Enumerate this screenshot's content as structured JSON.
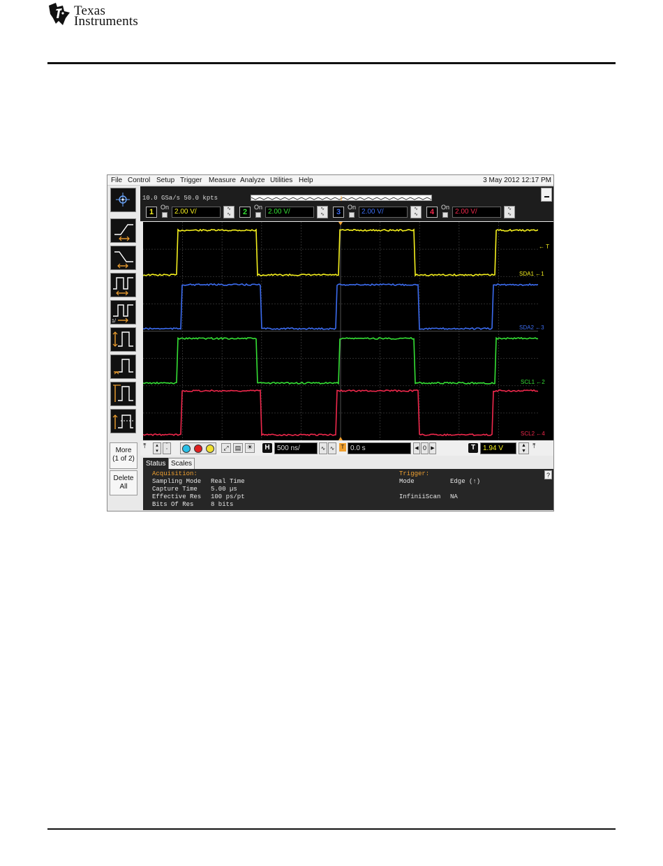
{
  "header": {
    "logo_line1": "Texas",
    "logo_line2": "Instruments"
  },
  "scope": {
    "menu": [
      "File",
      "Control",
      "Setup",
      "Trigger",
      "Measure",
      "Analyze",
      "Utilities",
      "Help"
    ],
    "datetime": "3 May 2012 12:17 PM",
    "sample_rate": "10.0 GSa/s",
    "memory_depth": "50.0 kpts",
    "channels": [
      {
        "number": "1",
        "state": "On",
        "scale": "2.00 V/",
        "color": "#f5f01e"
      },
      {
        "number": "2",
        "state": "On",
        "scale": "2.00 V/",
        "color": "#35e035"
      },
      {
        "number": "3",
        "state": "On",
        "scale": "2.00 V/",
        "color": "#3c6cf0"
      },
      {
        "number": "4",
        "state": "On",
        "scale": "2.00 V/",
        "color": "#f0284c"
      }
    ],
    "left_buttons": {
      "more_label": "More",
      "more_page": "(1 of 2)",
      "delete_line1": "Delete",
      "delete_line2": "All"
    },
    "waveform_labels": {
      "sda1": "SDA1",
      "sda2": "SDA2",
      "scl1": "SCL1",
      "scl2": "SCL2",
      "trigger_marker": "T",
      "ch1_marker": "1",
      "ch2_marker": "2",
      "ch3_marker": "3",
      "ch4_marker": "4"
    },
    "horizontal": {
      "label": "H",
      "timebase": "500 ns/",
      "delay_label": "T",
      "delay": "0.0 s",
      "nav_value": "0"
    },
    "trigger_level": {
      "label": "T",
      "value": "1.94 V"
    },
    "tabs": [
      "Status",
      "Scales"
    ],
    "status": {
      "acquisition_title": "Acquisition:",
      "sampling_mode_label": "Sampling Mode",
      "sampling_mode": "Real Time",
      "capture_time_label": "Capture Time",
      "capture_time": "5.00 µs",
      "effective_res_label": "Effective Res",
      "effective_res": "100 ps/pt",
      "bits_label": "Bits Of Res",
      "bits": "8 bits",
      "trigger_title": "Trigger:",
      "mode_label": "Mode",
      "mode": "Edge (↑)",
      "infiniiscan_label": "InfiniiScan",
      "infiniiscan": "NA",
      "help": "?"
    }
  }
}
